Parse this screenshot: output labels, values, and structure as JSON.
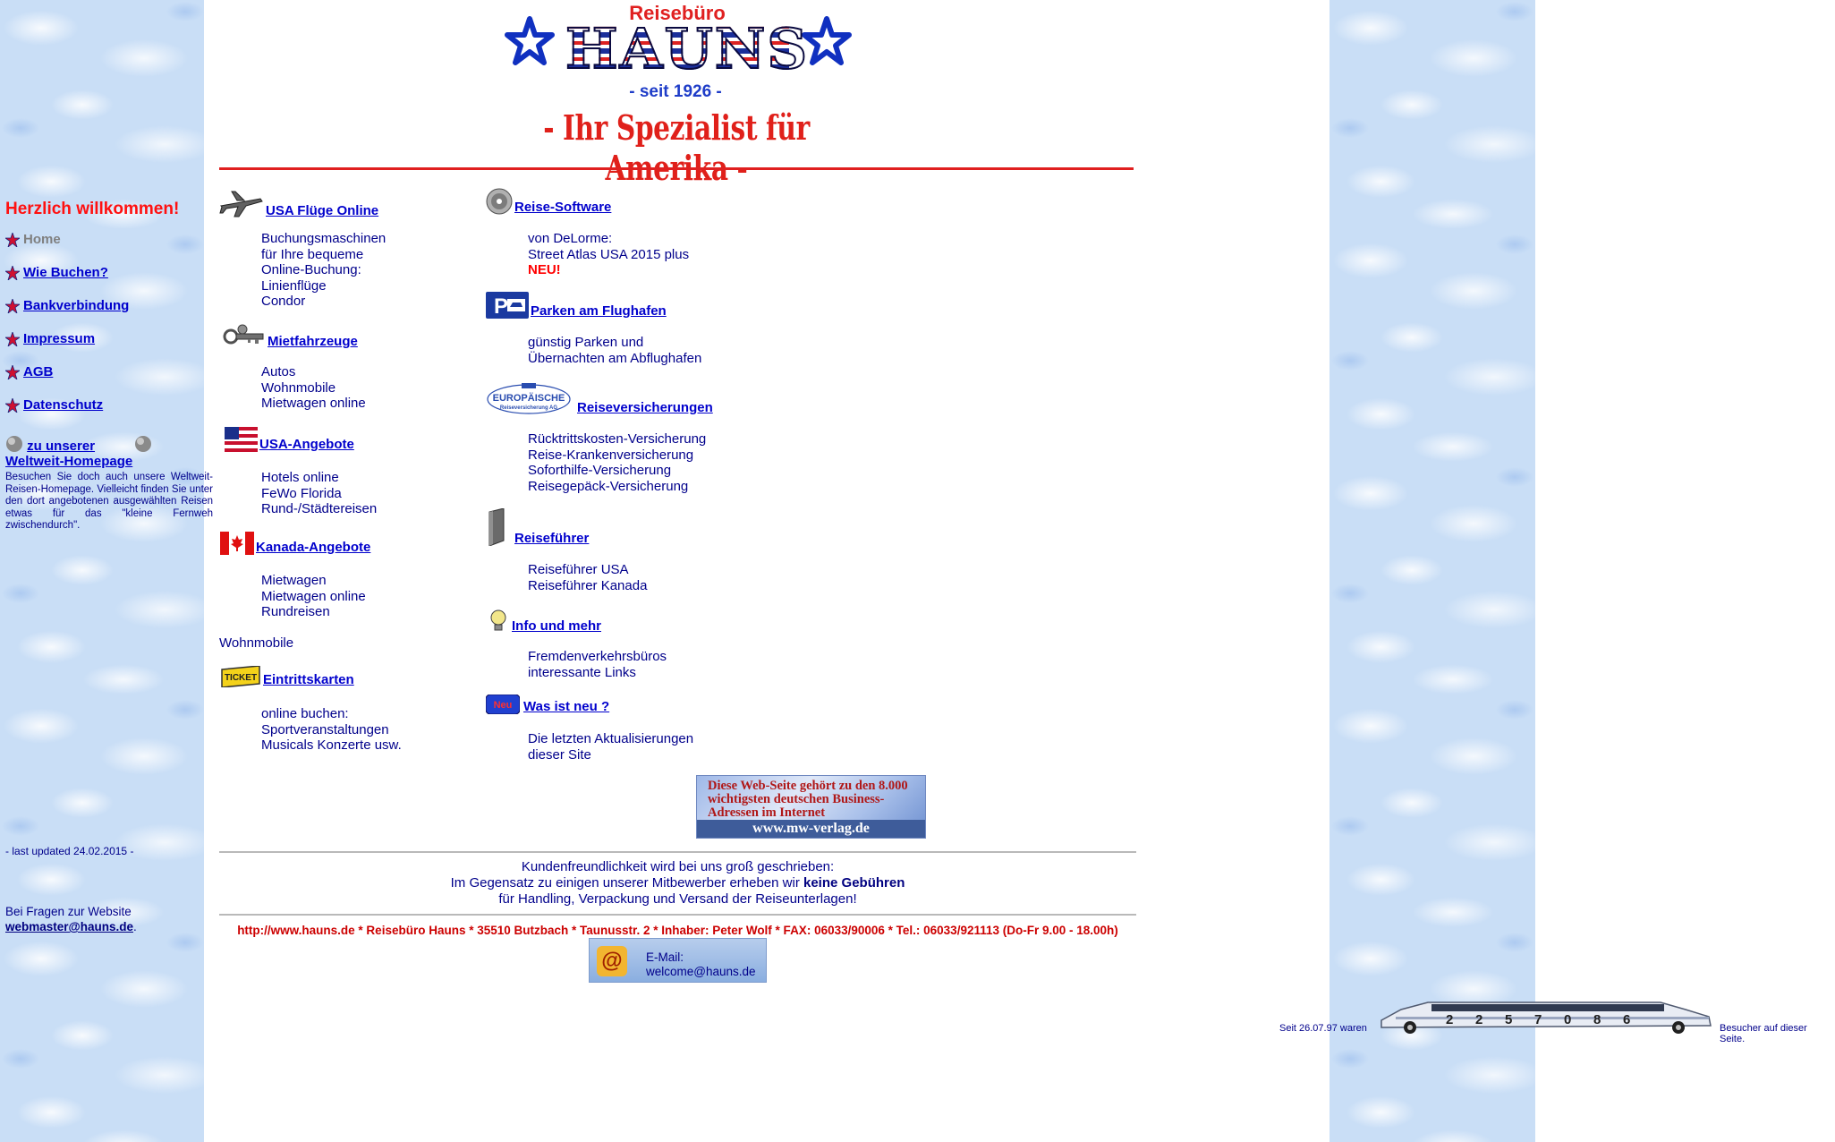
{
  "header": {
    "logo_sub": "Reisebüro",
    "logo_word": "HAUNS",
    "since": "- seit 1926 -",
    "slogan": "- Ihr Spezialist für Amerika -"
  },
  "sidebar": {
    "welcome": "Herzlich willkommen!",
    "items": [
      {
        "label": "Home",
        "current": true
      },
      {
        "label": "Wie Buchen?"
      },
      {
        "label": "Bankverbindung"
      },
      {
        "label": "Impressum"
      },
      {
        "label": "AGB"
      },
      {
        "label": "Datenschutz"
      }
    ],
    "weltweit_link_line1": "zu unserer",
    "weltweit_link_line2": "Weltweit-Homepage",
    "weltweit_desc": "Besuchen Sie doch auch unsere Weltweit-Reisen-Homepage. Vielleicht finden Sie unter den dort angebotenen ausgewählten Reisen etwas für das \"kleine Fernweh zwischendurch\".",
    "last_updated": "- last updated 24.02.2015 -",
    "questions_text": "Bei Fragen zur Website",
    "webmaster_email": "webmaster@hauns.de",
    "questions_end": "."
  },
  "sections": {
    "usa_fluege": {
      "title": "USA Flüge Online",
      "lines": [
        "Buchungsmaschinen",
        "für Ihre bequeme",
        "Online-Buchung:",
        "Linienflüge",
        "Condor"
      ]
    },
    "mietfahrzeuge": {
      "title": "Mietfahrzeuge",
      "lines": [
        "Autos",
        "Wohnmobile",
        "Mietwagen online"
      ]
    },
    "usa_angebote": {
      "title": "USA-Angebote",
      "lines": [
        "Hotels online",
        "FeWo Florida",
        "Rund-/Städtereisen"
      ]
    },
    "kanada_angebote": {
      "title": "Kanada-Angebote",
      "lines": [
        "Mietwagen",
        "Mietwagen online",
        "Rundreisen"
      ]
    },
    "wohnmobile": "Wohnmobile",
    "eintrittskarten": {
      "title": "Eintrittskarten",
      "lines": [
        "online buchen:",
        "Sportveranstaltungen",
        "Musicals Konzerte usw."
      ],
      "ticket_icon_text": "TICKET"
    },
    "reise_software": {
      "title": "Reise-Software",
      "lines": [
        "von DeLorme:",
        "Street Atlas USA 2015 plus"
      ],
      "new_label": "NEU!"
    },
    "parken": {
      "title": "Parken am Flughafen",
      "lines": [
        "günstig Parken und",
        "Übernachten am Abflughafen"
      ]
    },
    "versicherungen": {
      "title": "Reiseversicherungen",
      "lines": [
        "Rücktrittskosten-Versicherung",
        "Reise-Krankenversicherung",
        "Soforthilfe-Versicherung",
        "Reisegepäck-Versicherung"
      ],
      "logo_text": "EUROPÄISCHE",
      "logo_sub": "Reiseversicherung AG"
    },
    "reisefuehrer": {
      "title": "Reiseführer",
      "lines": [
        "Reiseführer USA",
        "Reiseführer Kanada"
      ]
    },
    "info": {
      "title": "Info und mehr",
      "lines": [
        "Fremdenverkehrsbüros",
        "interessante Links"
      ]
    },
    "neu": {
      "title": "Was ist neu ?",
      "lines": [
        "Die letzten Aktualisierungen",
        "dieser Site"
      ],
      "icon_text": "Neu"
    }
  },
  "mw_banner": {
    "text": "Diese Web-Seite gehört zu den 8.000 wichtigsten deutschen Business-Adressen im Internet",
    "url": "www.mw-verlag.de"
  },
  "footer": {
    "service_line1": "Kundenfreundlichkeit wird bei uns groß geschrieben:",
    "service_line2_pre": "Im Gegensatz zu einigen unserer Mitbewerber erheben wir ",
    "service_line2_bold": "keine Gebühren",
    "service_line3": "für Handling, Verpackung und Versand der Reiseunterlagen!",
    "address": "http://www.hauns.de * Reisebüro Hauns * 35510 Butzbach * Taunusstr. 2 * Inhaber: Peter Wolf * FAX: 06033/90006 * Tel.: 06033/921113 (Do-Fr 9.00 - 18.00h)",
    "email_label": "E-Mail:",
    "email_address": "welcome@hauns.de"
  },
  "counter": {
    "prefix": "Seit 26.07.97 waren",
    "digits": [
      "2",
      "2",
      "5",
      "7",
      "0",
      "8",
      "6"
    ],
    "suffix": "Besucher auf dieser Seite."
  },
  "colors": {
    "link": "#0000cc",
    "text": "#00008b",
    "accent_red": "#e02020",
    "sky": "#c9def6"
  }
}
